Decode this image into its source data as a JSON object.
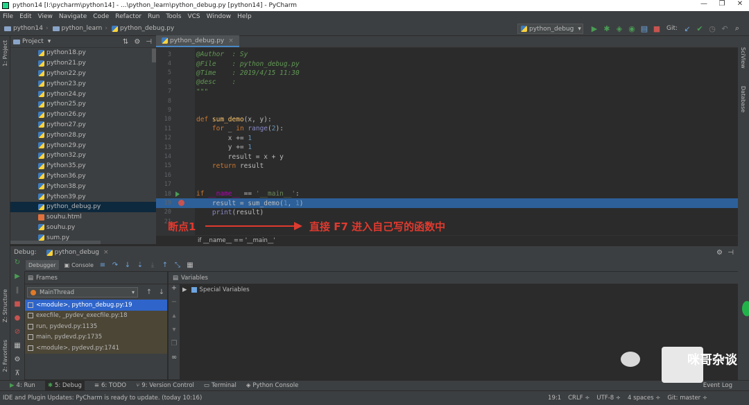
{
  "window": {
    "title": "python14 [I:\\pycharm\\python14] - ...\\python_learn\\python_debug.py [python14] - PyCharm",
    "minimize": "—",
    "maximize": "❐",
    "close": "✕"
  },
  "menu": [
    "File",
    "Edit",
    "View",
    "Navigate",
    "Code",
    "Refactor",
    "Run",
    "Tools",
    "VCS",
    "Window",
    "Help"
  ],
  "breadcrumbs": [
    "python14",
    "python_learn",
    "python_debug.py"
  ],
  "run_config": {
    "name": "python_debug",
    "dropdown": "▾"
  },
  "git_label": "Git:",
  "project_panel": {
    "title": "Project",
    "dropdown": "▾",
    "files": [
      "python18.py",
      "python21.py",
      "python22.py",
      "python23.py",
      "python24.py",
      "python25.py",
      "python26.py",
      "python27.py",
      "python28.py",
      "python29.py",
      "python32.py",
      "Python35.py",
      "Python36.py",
      "Python38.py",
      "Python39.py",
      "python_debug.py",
      "souhu.html",
      "souhu.py",
      "sum.py"
    ],
    "selected_index": 15
  },
  "left_strip": {
    "project": "1: Project",
    "structure": "Z: Structure",
    "favorites": "2: Favorites"
  },
  "right_strip": {
    "sciview": "SciView",
    "database": "Database"
  },
  "editor": {
    "tab": "python_debug.py",
    "tab_close": "×",
    "lines": [
      {
        "n": "3",
        "t": "@Author  : Sy"
      },
      {
        "n": "4",
        "t": "@File    : python_debug.py"
      },
      {
        "n": "5",
        "t": "@Time    : 2019/4/15 11:30"
      },
      {
        "n": "6",
        "t": "@desc    :"
      },
      {
        "n": "7",
        "t": "\"\"\""
      },
      {
        "n": "8",
        "t": ""
      },
      {
        "n": "9",
        "t": ""
      },
      {
        "n": "10",
        "t": "def sum_demo(x, y):"
      },
      {
        "n": "11",
        "t": "    for _ in range(2):"
      },
      {
        "n": "12",
        "t": "        x += 1"
      },
      {
        "n": "13",
        "t": "        y += 1"
      },
      {
        "n": "14",
        "t": "        result = x + y"
      },
      {
        "n": "15",
        "t": "    return result"
      },
      {
        "n": "16",
        "t": ""
      },
      {
        "n": "17",
        "t": ""
      },
      {
        "n": "18",
        "t": "if __name__ == '__main__':"
      },
      {
        "n": "19",
        "t": "    result = sum_demo(1, 1)"
      },
      {
        "n": "20",
        "t": "    print(result)"
      },
      {
        "n": "21",
        "t": ""
      }
    ],
    "breadcrumb": "if __name__ == '__main__'"
  },
  "annotation": {
    "left": "断点1",
    "right": "直接 F7 进入自己写的函数中"
  },
  "debug": {
    "label": "Debug:",
    "config": "python_debug",
    "tabs": {
      "debugger": "Debugger",
      "console": "Console"
    },
    "frames_title": "Frames",
    "thread": "MainThread",
    "frames": [
      "<module>, python_debug.py:19",
      "execfile, _pydev_execfile.py:18",
      "run, pydevd.py:1135",
      "main, pydevd.py:1735",
      "<module>, pydevd.py:1741"
    ],
    "selected_frame": 0,
    "variables_title": "Variables",
    "special_vars": "Special Variables"
  },
  "bottom_tabs": [
    "4: Run",
    "5: Debug",
    "6: TODO",
    "9: Version Control",
    "Terminal",
    "Python Console"
  ],
  "event_log": "Event Log",
  "status": {
    "message": "IDE and Plugin Updates: PyCharm is ready to update. (today 10:16)",
    "position": "19:1",
    "line_sep": "CRLF ÷",
    "encoding": "UTF-8 ÷",
    "indent": "4 spaces ÷",
    "git": "Git: master ÷"
  },
  "watermark": "咪哥杂谈",
  "colors": {
    "accent": "#2f65ca",
    "breakpoint": "#c75450",
    "annotation": "#e03a2f"
  }
}
